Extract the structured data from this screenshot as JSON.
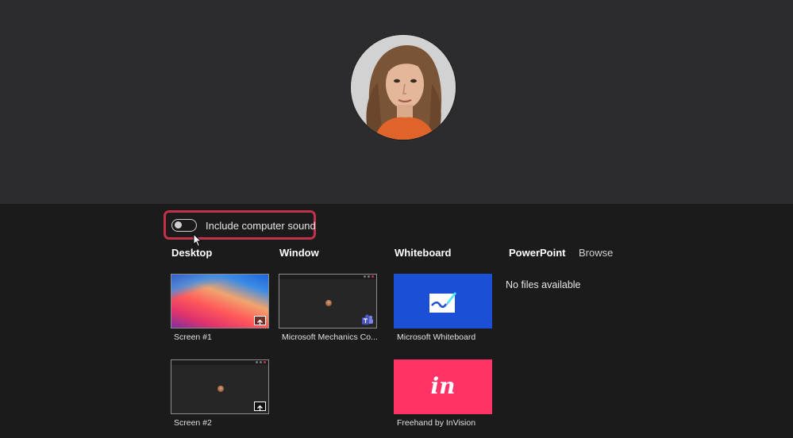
{
  "options": {
    "include_sound_label": "Include computer sound",
    "include_sound_enabled": false
  },
  "sections": {
    "desktop": "Desktop",
    "window": "Window",
    "whiteboard": "Whiteboard",
    "powerpoint": "PowerPoint",
    "browse": "Browse"
  },
  "powerpoint": {
    "empty_text": "No files available"
  },
  "desktop_items": [
    {
      "label": "Screen #1"
    },
    {
      "label": "Screen #2"
    }
  ],
  "window_items": [
    {
      "label": "Microsoft Mechanics Co..."
    }
  ],
  "whiteboard_items": [
    {
      "label": "Microsoft Whiteboard"
    },
    {
      "label": "Freehand by InVision",
      "logo_text": "in"
    }
  ],
  "colors": {
    "highlight_border": "#c4314b",
    "whiteboard_blue": "#1b4fd6",
    "invision_pink": "#ff3366"
  }
}
